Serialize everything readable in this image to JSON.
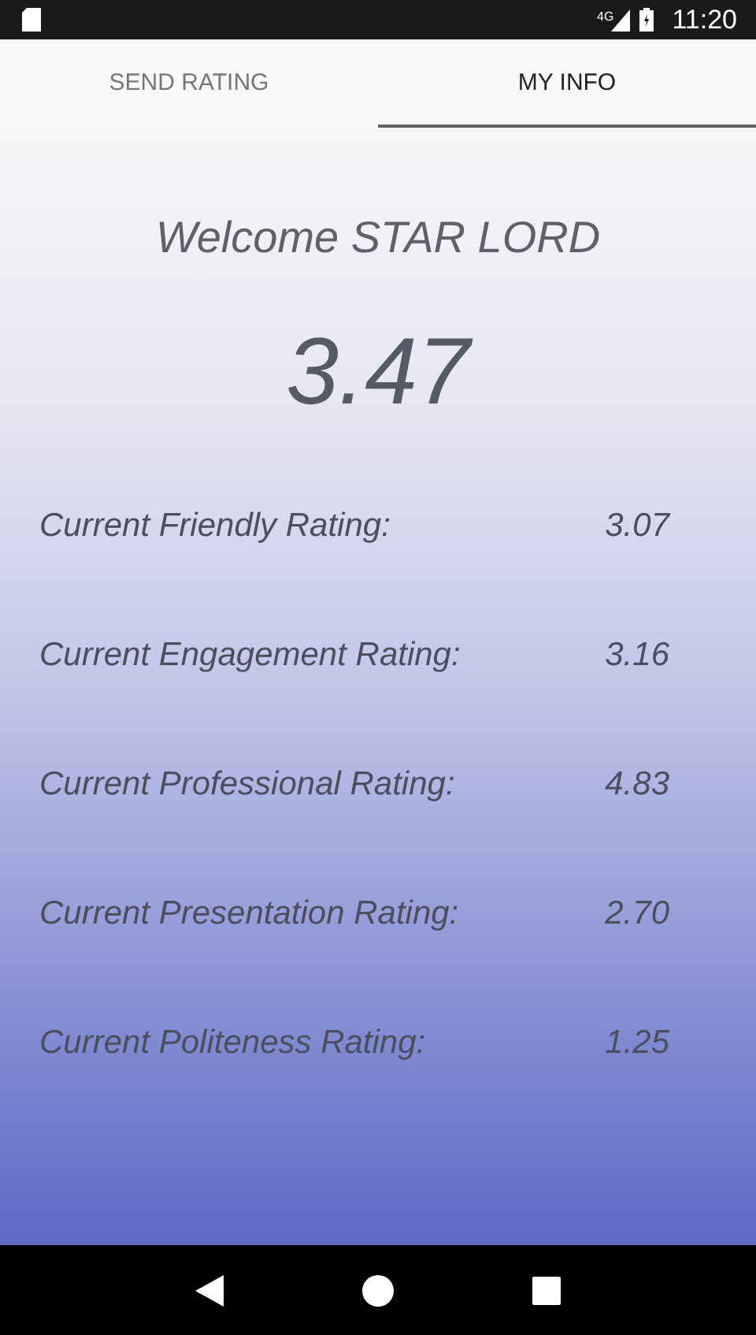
{
  "status_bar": {
    "network_type": "4G",
    "time": "11:20"
  },
  "tabs": [
    {
      "label": "SEND RATING",
      "selected": false
    },
    {
      "label": "MY INFO",
      "selected": true
    }
  ],
  "welcome": "Welcome STAR LORD",
  "overall_rating": "3.47",
  "ratings": [
    {
      "label": "Current Friendly Rating:",
      "value": "3.07"
    },
    {
      "label": "Current Engagement Rating:",
      "value": "3.16"
    },
    {
      "label": "Current Professional Rating:",
      "value": "4.83"
    },
    {
      "label": "Current Presentation Rating:",
      "value": "2.70"
    },
    {
      "label": "Current Politeness Rating:",
      "value": "1.25"
    }
  ]
}
